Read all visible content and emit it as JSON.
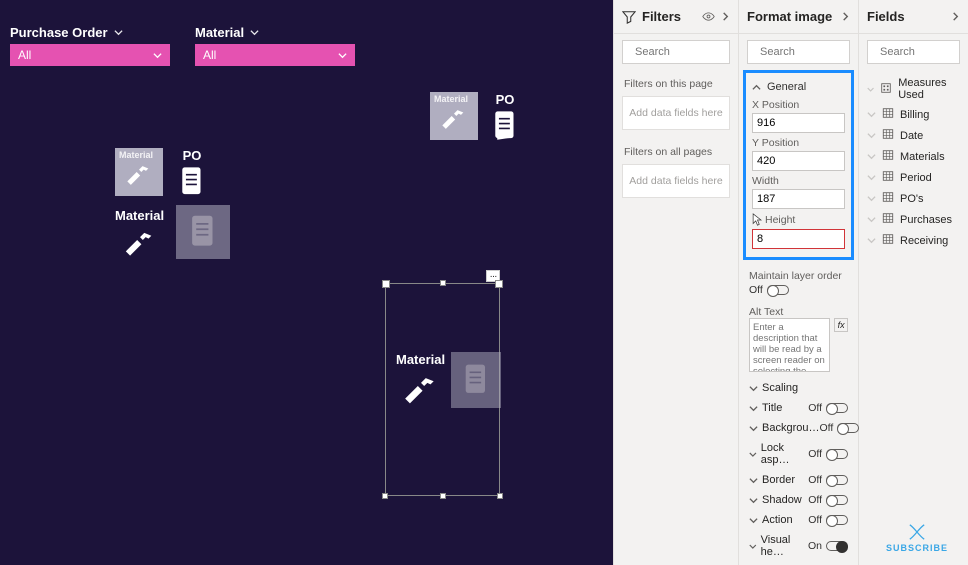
{
  "canvas": {
    "slicers": [
      {
        "label": "Purchase Order",
        "value": "All"
      },
      {
        "label": "Material",
        "value": "All"
      }
    ],
    "labels": {
      "po": "PO",
      "material": "Material"
    },
    "selection_options_glyph": "···"
  },
  "filters": {
    "title": "Filters",
    "search_placeholder": "Search",
    "sections": {
      "page_label": "Filters on this page",
      "page_drop": "Add data fields here",
      "all_label": "Filters on all pages",
      "all_drop": "Add data fields here"
    }
  },
  "format": {
    "title": "Format image",
    "search_placeholder": "Search",
    "general": {
      "header": "General",
      "x_label": "X Position",
      "x_value": "916",
      "y_label": "Y Position",
      "y_value": "420",
      "w_label": "Width",
      "w_value": "187",
      "h_label": "Height",
      "h_value": "8"
    },
    "maintain": {
      "label": "Maintain layer order",
      "state": "Off"
    },
    "alt": {
      "label": "Alt Text",
      "placeholder": "Enter a description that will be read by a screen reader on selecting the visual.",
      "fx": "fx"
    },
    "sections": [
      {
        "label": "Scaling",
        "state": ""
      },
      {
        "label": "Title",
        "state": "Off"
      },
      {
        "label": "Backgrou…",
        "state": "Off"
      },
      {
        "label": "Lock asp…",
        "state": "Off"
      },
      {
        "label": "Border",
        "state": "Off"
      },
      {
        "label": "Shadow",
        "state": "Off"
      },
      {
        "label": "Action",
        "state": "Off"
      },
      {
        "label": "Visual he…",
        "state": "On"
      }
    ]
  },
  "fields": {
    "title": "Fields",
    "search_placeholder": "Search",
    "items": [
      {
        "icon": "measure",
        "label": "Measures Used"
      },
      {
        "icon": "table",
        "label": "Billing"
      },
      {
        "icon": "table",
        "label": "Date"
      },
      {
        "icon": "table",
        "label": "Materials"
      },
      {
        "icon": "table",
        "label": "Period"
      },
      {
        "icon": "table",
        "label": "PO's"
      },
      {
        "icon": "table",
        "label": "Purchases"
      },
      {
        "icon": "table",
        "label": "Receiving"
      }
    ]
  },
  "badge": "SUBSCRIBE"
}
